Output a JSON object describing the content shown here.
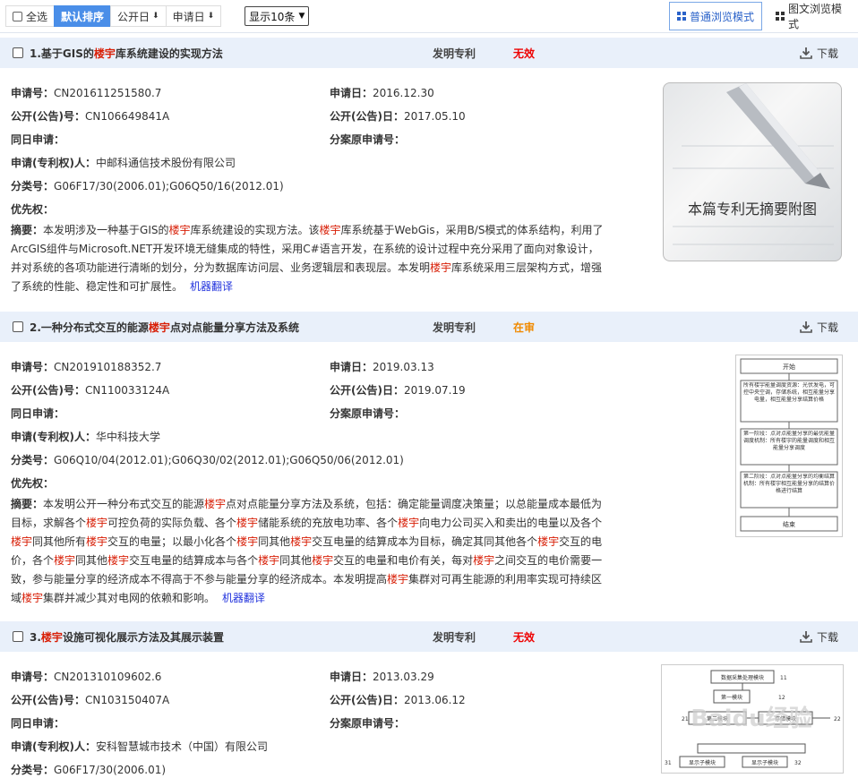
{
  "toolbar": {
    "select_all": "全选",
    "default_sort": "默认排序",
    "pub_date": "公开日",
    "app_date": "申请日",
    "page_size": "显示10条",
    "mode_normal": "普通浏览模式",
    "mode_image": "图文浏览模式"
  },
  "labels": {
    "app_no": "申请号：",
    "pub_no": "公开(公告)号：",
    "same_day": "同日申请：",
    "applicant": "申请(专利权)人：",
    "ipc": "分类号：",
    "priority": "优先权：",
    "app_date": "申请日：",
    "pub_date": "公开(公告)日：",
    "divisional": "分案原申请号：",
    "abstract": "摘要：",
    "download": "下载",
    "machine_translate": "机器翻译"
  },
  "records": [
    {
      "title_pre": "1.基于GIS的",
      "title_hl": "楼宇",
      "title_post": "库系统建设的实现方法",
      "type": "发明专利",
      "status": "无效",
      "app_no": "CN201611251580.7",
      "pub_no": "CN106649841A",
      "applicant": "中邮科通信技术股份有限公司",
      "ipc": "G06F17/30(2006.01);G06Q50/16(2012.01)",
      "app_date": "2016.12.30",
      "pub_date": "2017.05.10",
      "abstract": [
        "本发明涉及一种基于GIS的",
        "楼宇",
        "库系统建设的实现方法。该",
        "楼宇",
        "库系统基于WebGis，采用B/S模式的体系结构，利用了ArcGIS组件与Microsoft.NET开发环境无缝集成的特性，采用C#语言开发，在系统的设计过程中充分采用了面向对象设计，并对系统的各项功能进行清晰的划分，分为数据库访问层、业务逻辑层和表现层。本发明",
        "楼宇",
        "库系统采用三层架构方式，增强了系统的性能、稳定性和可扩展性。"
      ],
      "thumb_text": "本篇专利无摘要附图"
    },
    {
      "title_pre": "2.一种分布式交互的能源",
      "title_hl": "楼宇",
      "title_post": "点对点能量分享方法及系统",
      "type": "发明专利",
      "status": "在审",
      "app_no": "CN201910188352.7",
      "pub_no": "CN110033124A",
      "applicant": "华中科技大学",
      "ipc": "G06Q10/04(2012.01);G06Q30/02(2012.01);G06Q50/06(2012.01)",
      "app_date": "2019.03.13",
      "pub_date": "2019.07.19",
      "abstract": [
        "本发明公开一种分布式交互的能源",
        "楼宇",
        "点对点能量分享方法及系统，包括：确定能量调度决策量；以总能量成本最低为目标，求解各个",
        "楼宇",
        "可控负荷的实际负载、各个",
        "楼宇",
        "储能系统的充放电功率、各个",
        "楼宇",
        "向电力公司买入和卖出的电量以及各个",
        "楼宇",
        "同其他所有",
        "楼宇",
        "交互的电量；以最小化各个",
        "楼宇",
        "同其他",
        "楼宇",
        "交互电量的结算成本为目标，确定其同其他各个",
        "楼宇",
        "交互的电价，各个",
        "楼宇",
        "同其他",
        "楼宇",
        "交互电量的结算成本与各个",
        "楼宇",
        "同其他",
        "楼宇",
        "交互的电量和电价有关，每对",
        "楼宇",
        "之间交互的电价需要一致，参与能量分享的经济成本不得高于不参与能量分享的经济成本。本发明提高",
        "楼宇",
        "集群对可再生能源的利用率实现可持续区域",
        "楼宇",
        "集群并减少其对电网的依赖和影响。"
      ],
      "flow": [
        "开始",
        "所有楼宇能量调度资源：光伏发电，可控中央空调，存储系统，相互能量分享电量，相互能量分享结算价格",
        "第一阶段：点对点能量分享的最优能量调度机制：所有楼宇的能量调度和相互能量分享调度",
        "第二阶段：点对点能量分享的均衡结算机制：所有楼宇相互能量分享的结算价格进行结算",
        "结束"
      ]
    },
    {
      "title_pre": "3.",
      "title_hl": "楼宇",
      "title_post": "设施可视化展示方法及其展示装置",
      "type": "发明专利",
      "status": "无效",
      "app_no": "CN201310109602.6",
      "pub_no": "CN103150407A",
      "applicant": "安科智慧城市技术（中国）有限公司",
      "ipc": "G06F17/30(2006.01)",
      "app_date": "2013.03.29",
      "pub_date": "2013.06.12",
      "diagram_labels": [
        "数据采集处理模块",
        "第一模块",
        "第二模块",
        "存储模块",
        "显示子模块",
        "11",
        "12",
        "21",
        "22",
        "31",
        "32"
      ],
      "watermark": "Baidu经验"
    }
  ],
  "colors": {
    "accent": "#4a8ee8",
    "header_bg": "#e9f0fa",
    "highlight": "#d81e06",
    "invalid": "#e00000",
    "pending": "#f08a00",
    "link": "#2233dd"
  }
}
